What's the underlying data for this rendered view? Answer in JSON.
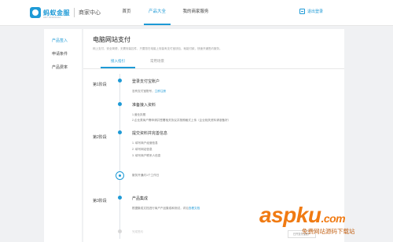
{
  "header": {
    "logo_text": "蚂蚁金服",
    "logo_sub": "ANT FINANCIAL",
    "logo_center": "商家中心",
    "nav": [
      {
        "label": "首页"
      },
      {
        "label": "产品大全"
      },
      {
        "label": "我的商家服务"
      }
    ],
    "signin_label": "退出登录"
  },
  "sidebar": {
    "items": [
      {
        "label": "产品签入"
      },
      {
        "label": "申请条件"
      },
      {
        "label": "产品费率"
      }
    ]
  },
  "main": {
    "title": "电脑网站支付",
    "description": "网上支付，安全简便，无需安装控件，只要您在电脑上安装有支付宝钱包，就能付款，快速开通签约服务。",
    "tabs": [
      {
        "label": "接入指引"
      },
      {
        "label": "常用场景"
      }
    ],
    "stages": [
      {
        "label": "第1阶段"
      },
      {
        "label": "第2阶段"
      },
      {
        "label": "第3阶段"
      }
    ],
    "steps": {
      "s1_title": "登录支付宝账户",
      "s1_text_a": "没有支付宝账号，",
      "s1_text_link": "立即注册",
      "s2_title": "准备接入资料",
      "s2_line1": "1.营业执照",
      "s2_line2": "2.企业类商户需申请并签署相关协议并按照格式上传（企业相关资料请准备好）",
      "s3_title": "提交资料并完善信息",
      "s3_line1": "1. 填写商户经营信息",
      "s3_line2": "2. 填写网站信息",
      "s3_line3": "3. 填写商户联系人信息",
      "wait_text": "服务开通约1个工作日",
      "s4_title": "产品集成",
      "s4_text_a": "根据集成文档进行商户产品集成和测试，详见",
      "s4_text_link": "查看文档",
      "s5_text": "完成签约",
      "bottom_badge": "已开支付宝账户"
    }
  },
  "watermark": {
    "main": "aspku",
    "tld": ".com",
    "sub": "免费网站源码下载站"
  }
}
